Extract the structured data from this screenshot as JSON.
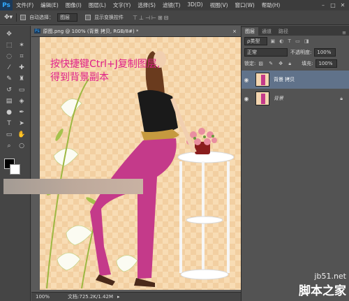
{
  "menubar": {
    "logo": "Ps",
    "items": [
      "文件(F)",
      "编辑(E)",
      "图像(I)",
      "图层(L)",
      "文字(Y)",
      "选择(S)",
      "滤镜(T)",
      "3D(D)",
      "视图(V)",
      "窗口(W)",
      "帮助(H)"
    ]
  },
  "options": {
    "auto_select_label": "自动选择：",
    "auto_select_value": "图层",
    "show_transform_label": "显示变换控件"
  },
  "document": {
    "tab_title": "原图.png @ 100% (背景 拷贝, RGB/8#) *",
    "overlay_text": "按快捷键Ctrl+J复制图层,\n得到背景副本"
  },
  "status": {
    "zoom": "100%",
    "doc_info": "文档:725.2K/1.42M"
  },
  "layers_panel": {
    "tabs": [
      "图层",
      "通道",
      "路径"
    ],
    "filter_kind": "ρ类型",
    "blend_mode": "正常",
    "opacity_label": "不透明度:",
    "opacity_value": "100%",
    "lock_label": "锁定:",
    "fill_label": "填充:",
    "fill_value": "100%",
    "layers": [
      {
        "name": "背景 拷贝",
        "selected": true
      },
      {
        "name": "背景",
        "selected": false
      }
    ]
  },
  "watermark": {
    "site": "jb51.net",
    "brand": "脚本之家"
  },
  "colors": {
    "accent_text": "#e0208a",
    "selected_layer": "#60728a"
  }
}
